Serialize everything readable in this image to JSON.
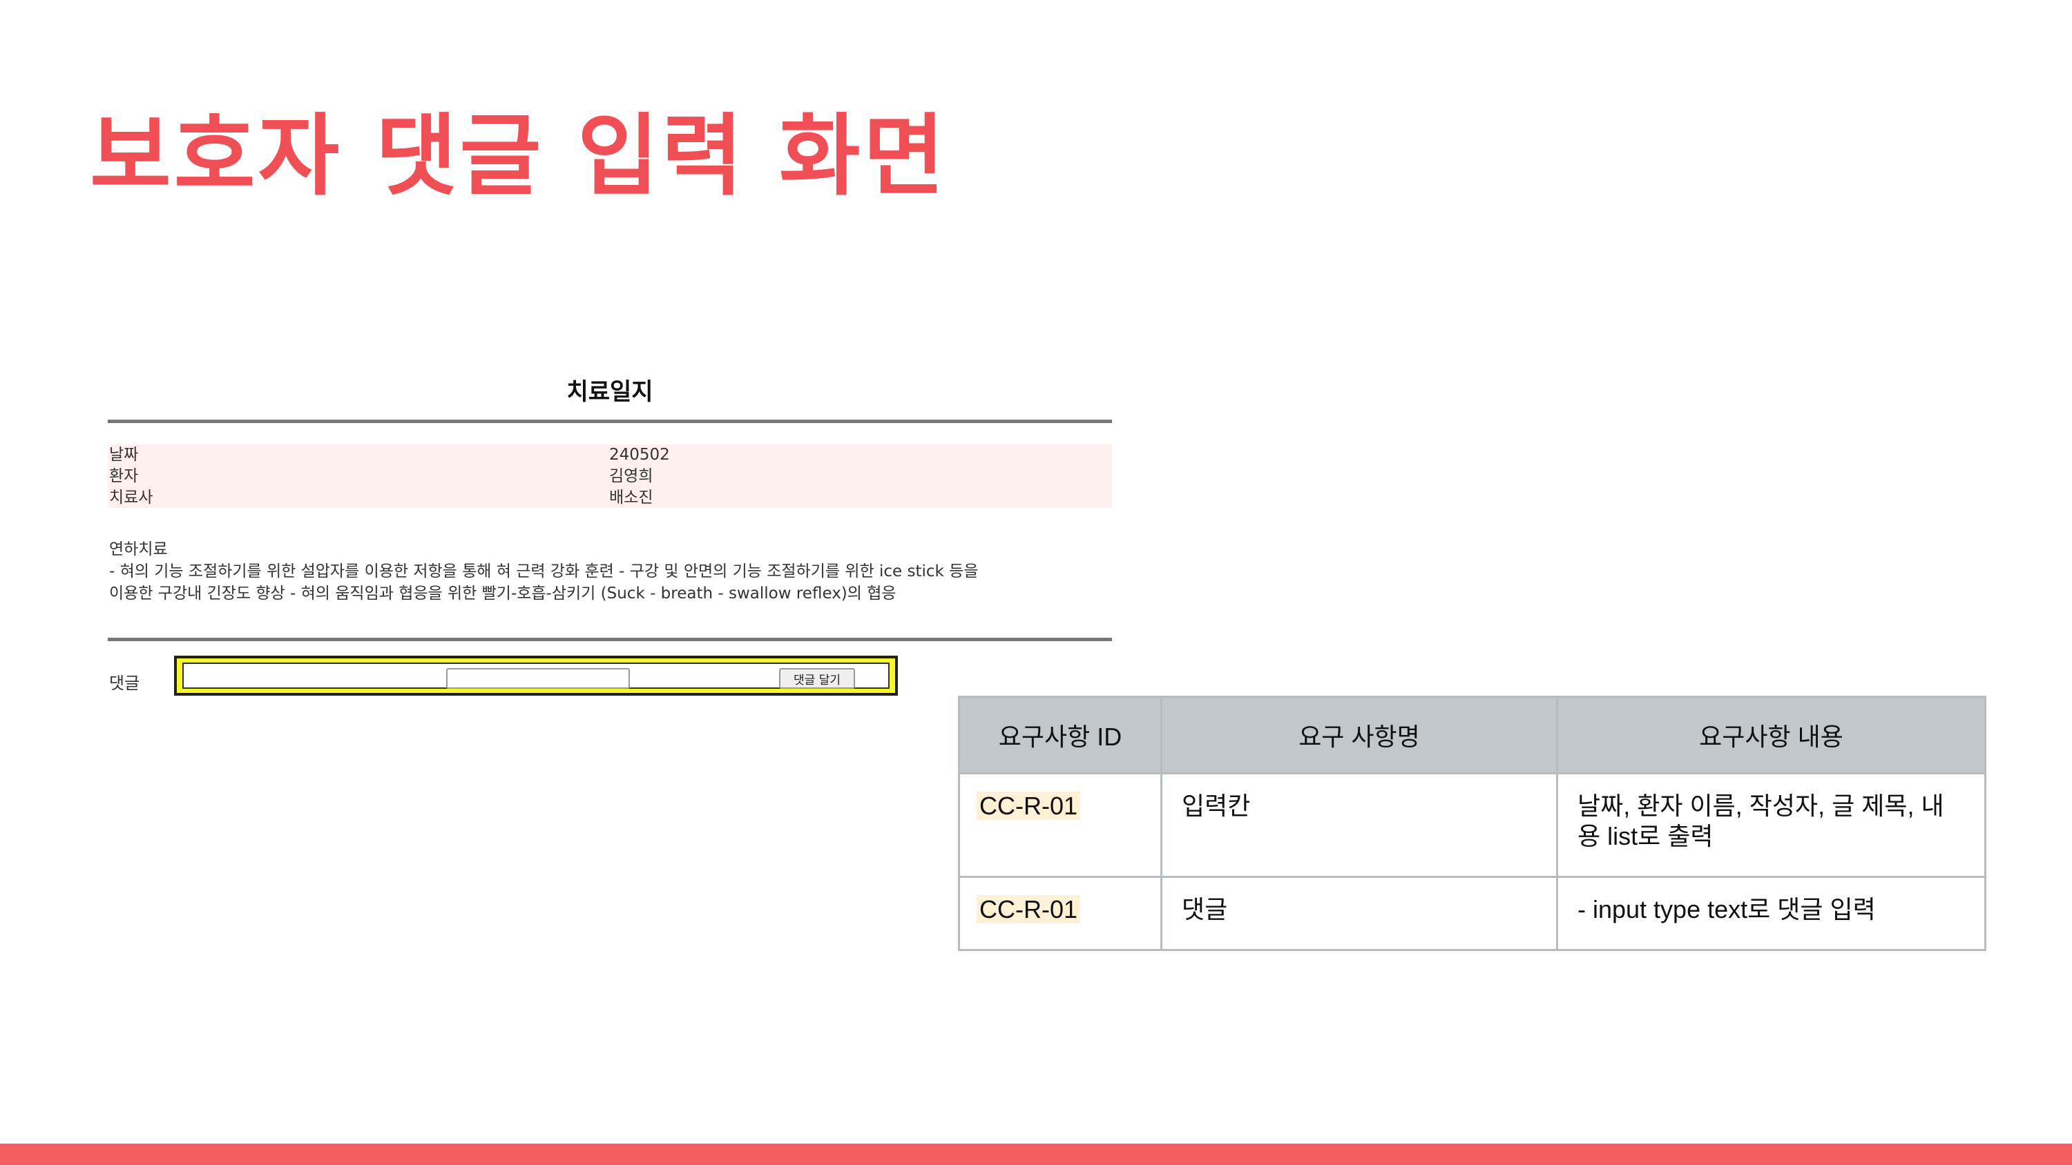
{
  "slide": {
    "title": "보호자 댓글 입력 화면"
  },
  "screenshot": {
    "title": "치료일지",
    "info": [
      {
        "label": "날짜",
        "value": "240502"
      },
      {
        "label": "환자",
        "value": "김영희"
      },
      {
        "label": "치료사",
        "value": "배소진"
      }
    ],
    "treatment": {
      "heading": "연하치료",
      "line1": "- 혀의 기능 조절하기를 위한 설압자를 이용한 저항을 통해 혀 근력 강화 훈련 - 구강 및 안면의 기능 조절하기를 위한 ice stick 등을",
      "line2": "이용한 구강내 긴장도 향상 - 혀의 움직임과 협응을 위한 빨기-호흡-삼키기 (Suck - breath - swallow reflex)의 협응"
    },
    "comment": {
      "label": "댓글",
      "input_value": "",
      "button_label": "댓글 달기"
    }
  },
  "table": {
    "headers": [
      "요구사항 ID",
      "요구 사항명",
      "요구사항 내용"
    ],
    "rows": [
      {
        "id": "CC-R-01",
        "name": "입력칸",
        "content": "날짜, 환자 이름, 작성자, 글 제목, 내용 list로 출력"
      },
      {
        "id": "CC-R-01",
        "name": "댓글",
        "content": "- input type text로 댓글 입력"
      }
    ]
  },
  "colors": {
    "title": "#ef4f55",
    "bottom_bar": "#f25d5f",
    "info_background": "#fdf0ee",
    "comment_highlight": "#f5f52a",
    "table_header": "#c2c7cb",
    "id_highlight": "#fdf1d6"
  }
}
